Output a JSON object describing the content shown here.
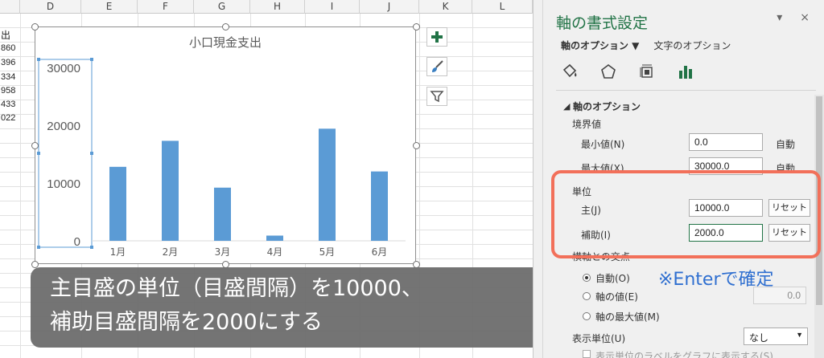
{
  "sheet": {
    "columns": [
      "D",
      "E",
      "F",
      "G",
      "H",
      "I",
      "J",
      "K",
      "L"
    ],
    "partial_col_header": "出",
    "partial_values": [
      "860",
      "396",
      "334",
      "958",
      "433",
      "022"
    ]
  },
  "chart": {
    "title": "小口現金支出"
  },
  "chart_data": {
    "type": "bar",
    "title": "小口現金支出",
    "categories": [
      "1月",
      "2月",
      "3月",
      "4月",
      "5月",
      "6月"
    ],
    "values": [
      12800,
      17300,
      9200,
      900,
      19400,
      12000
    ],
    "ylim": [
      0,
      30000
    ],
    "yticks": [
      "0",
      "10000",
      "20000",
      "30000"
    ],
    "color": "#5b9bd5",
    "grid": false
  },
  "caption": {
    "line1": "主目盛の単位（目盛間隔）を10000、",
    "line2": "補助目盛間隔を2000にする"
  },
  "pane": {
    "title": "軸の書式設定",
    "close": "×",
    "collapse": "▾",
    "tab_axis_options": "軸のオプション ▼",
    "tab_text_options": "文字のオプション",
    "section": "軸のオプション",
    "bounds_label": "境界値",
    "min_label": "最小値(N)",
    "min_value": "0.0",
    "min_state": "自動",
    "max_label": "最大値(X)",
    "max_value": "30000.0",
    "max_state": "自動",
    "units_label": "単位",
    "major_label": "主(J)",
    "major_value": "10000.0",
    "minor_label": "補助(I)",
    "minor_value": "2000.0",
    "reset": "リセット",
    "cross_label": "横軸との交点",
    "auto_label": "自動(O)",
    "axis_value_label": "軸の値(E)",
    "axis_value": "0.0",
    "axis_max_label": "軸の最大値(M)",
    "display_unit_label": "表示単位(U)",
    "display_unit_value": "なし",
    "show_label_text": "表示単位のラベルをグラフに表示する(S)",
    "enter_note": "※Enterで確定"
  }
}
